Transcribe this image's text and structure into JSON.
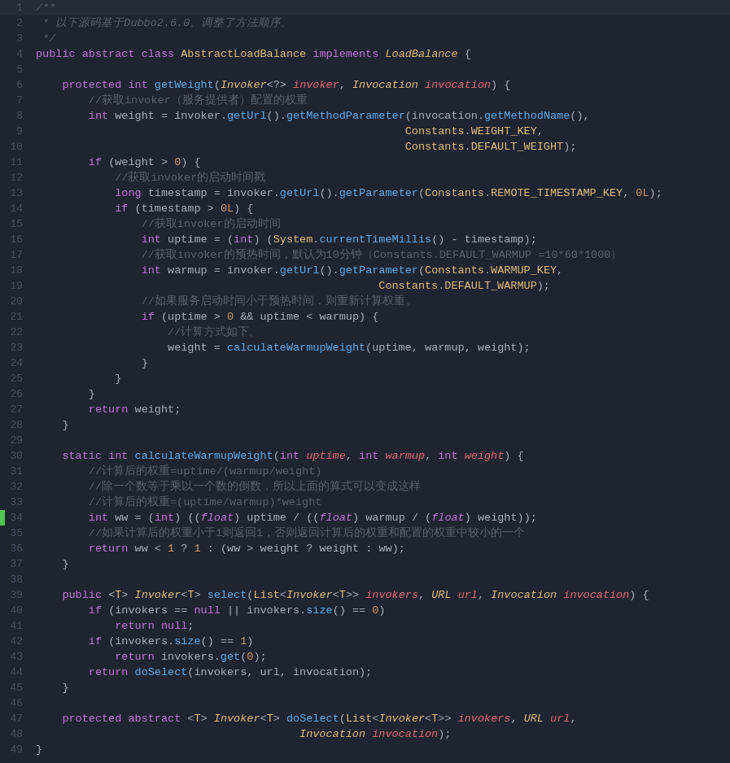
{
  "editor": {
    "background": "#1e2430",
    "lines": [
      {
        "num": 1,
        "tokens": [
          {
            "t": "comment",
            "v": "/**"
          }
        ]
      },
      {
        "num": 2,
        "tokens": [
          {
            "t": "comment",
            "v": " * 以下源码基于Dubbo2.6.0。调整了方法顺序。"
          }
        ]
      },
      {
        "num": 3,
        "tokens": [
          {
            "t": "comment",
            "v": " */"
          }
        ]
      },
      {
        "num": 4,
        "tokens": [
          {
            "t": "line4"
          }
        ]
      },
      {
        "num": 5,
        "tokens": [
          {
            "t": "plain",
            "v": ""
          }
        ]
      },
      {
        "num": 6,
        "tokens": [
          {
            "t": "line6"
          }
        ]
      },
      {
        "num": 7,
        "tokens": [
          {
            "t": "comment-cn",
            "v": "        //获取invoker（服务提供者）配置的权重"
          }
        ]
      },
      {
        "num": 8,
        "tokens": [
          {
            "t": "line8"
          }
        ]
      },
      {
        "num": 9,
        "tokens": [
          {
            "t": "line9"
          }
        ]
      },
      {
        "num": 10,
        "tokens": [
          {
            "t": "line10"
          }
        ]
      },
      {
        "num": 11,
        "tokens": [
          {
            "t": "line11"
          }
        ]
      },
      {
        "num": 12,
        "tokens": [
          {
            "t": "comment-cn",
            "v": "            //获取invoker的启动时间戳"
          }
        ]
      },
      {
        "num": 13,
        "tokens": [
          {
            "t": "line13"
          }
        ]
      },
      {
        "num": 14,
        "tokens": [
          {
            "t": "line14"
          }
        ]
      },
      {
        "num": 15,
        "tokens": [
          {
            "t": "comment-cn",
            "v": "                //获取invoker的启动时间"
          }
        ]
      },
      {
        "num": 16,
        "tokens": [
          {
            "t": "line16"
          }
        ]
      },
      {
        "num": 17,
        "tokens": [
          {
            "t": "comment-cn",
            "v": "                //获取invoker的预热时间，默认为10分钟（Constants.DEFAULT_WARMUP =10*60*1000）"
          }
        ]
      },
      {
        "num": 18,
        "tokens": [
          {
            "t": "line18"
          }
        ]
      },
      {
        "num": 19,
        "tokens": [
          {
            "t": "line19"
          }
        ]
      },
      {
        "num": 20,
        "tokens": [
          {
            "t": "comment-cn",
            "v": "                //如果服务启动时间小于预热时间，则重新计算权重。"
          }
        ]
      },
      {
        "num": 21,
        "tokens": [
          {
            "t": "line21"
          }
        ]
      },
      {
        "num": 22,
        "tokens": [
          {
            "t": "comment-cn",
            "v": "                    //计算方式如下。"
          }
        ]
      },
      {
        "num": 23,
        "tokens": [
          {
            "t": "line23"
          }
        ]
      },
      {
        "num": 24,
        "tokens": [
          {
            "t": "plain",
            "v": "                }"
          }
        ]
      },
      {
        "num": 25,
        "tokens": [
          {
            "t": "plain",
            "v": "            }"
          }
        ]
      },
      {
        "num": 26,
        "tokens": [
          {
            "t": "plain",
            "v": "        }"
          }
        ]
      },
      {
        "num": 27,
        "tokens": [
          {
            "t": "line27"
          }
        ]
      },
      {
        "num": 28,
        "tokens": [
          {
            "t": "plain",
            "v": "    }"
          }
        ]
      },
      {
        "num": 29,
        "tokens": [
          {
            "t": "plain",
            "v": ""
          }
        ]
      },
      {
        "num": 30,
        "tokens": [
          {
            "t": "line30"
          }
        ]
      },
      {
        "num": 31,
        "tokens": [
          {
            "t": "comment-cn",
            "v": "        //计算后的权重=uptime/(warmup/weight)"
          }
        ]
      },
      {
        "num": 32,
        "tokens": [
          {
            "t": "comment-cn",
            "v": "        //除一个数等于乘以一个数的倒数，所以上面的算式可以变成这样"
          }
        ]
      },
      {
        "num": 33,
        "tokens": [
          {
            "t": "comment-cn",
            "v": "        //计算后的权重=(uptime/warmup)*weight"
          }
        ]
      },
      {
        "num": 34,
        "tokens": [
          {
            "t": "line34",
            "highlight": true
          }
        ]
      },
      {
        "num": 35,
        "tokens": [
          {
            "t": "comment-cn",
            "v": "        //如果计算后的权重小于1则返回1，否则返回计算后的权重和配置的权重中较小的一个"
          }
        ]
      },
      {
        "num": 36,
        "tokens": [
          {
            "t": "line36"
          }
        ]
      },
      {
        "num": 37,
        "tokens": [
          {
            "t": "plain",
            "v": "    }"
          }
        ]
      },
      {
        "num": 38,
        "tokens": [
          {
            "t": "plain",
            "v": ""
          }
        ]
      },
      {
        "num": 39,
        "tokens": [
          {
            "t": "line39"
          }
        ]
      },
      {
        "num": 40,
        "tokens": [
          {
            "t": "line40"
          }
        ]
      },
      {
        "num": 41,
        "tokens": [
          {
            "t": "line41"
          }
        ]
      },
      {
        "num": 42,
        "tokens": [
          {
            "t": "line42"
          }
        ]
      },
      {
        "num": 43,
        "tokens": [
          {
            "t": "line43"
          }
        ]
      },
      {
        "num": 44,
        "tokens": [
          {
            "t": "line44"
          }
        ]
      },
      {
        "num": 45,
        "tokens": [
          {
            "t": "plain",
            "v": "    }"
          }
        ]
      },
      {
        "num": 46,
        "tokens": [
          {
            "t": "plain",
            "v": ""
          }
        ]
      },
      {
        "num": 47,
        "tokens": [
          {
            "t": "line47"
          }
        ]
      },
      {
        "num": 48,
        "tokens": [
          {
            "t": "line48"
          }
        ]
      },
      {
        "num": 49,
        "tokens": [
          {
            "t": "plain",
            "v": "}"
          }
        ]
      }
    ]
  }
}
